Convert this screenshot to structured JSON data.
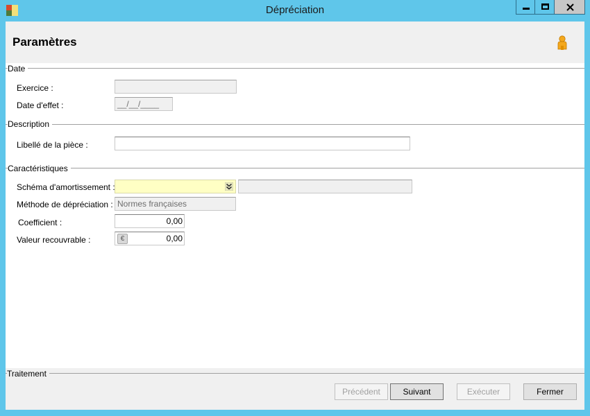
{
  "window": {
    "title": "Dépréciation"
  },
  "header": {
    "title": "Paramètres"
  },
  "sections": {
    "date": {
      "label": "Date",
      "exercice_label": "Exercice :",
      "exercice_value": "",
      "date_effet_label": "Date d'effet :",
      "date_effet_value": "__/__/____"
    },
    "description": {
      "label": "Description",
      "libelle_label": "Libellé de la pièce :",
      "libelle_value": ""
    },
    "caracteristiques": {
      "label": "Caractéristiques",
      "schema_label": "Schéma d'amortissement :",
      "schema_value": "",
      "schema_description": "",
      "methode_label": "Méthode de dépréciation :",
      "methode_value": "Normes françaises",
      "coefficient_label": "Coefficient :",
      "coefficient_value": "0,00",
      "valeur_label": "Valeur recouvrable :",
      "valeur_value": "0,00",
      "currency_symbol": "€"
    }
  },
  "footer": {
    "label": "Traitement",
    "buttons": {
      "precedent": "Précédent",
      "suivant": "Suivant",
      "executer": "Exécuter",
      "fermer": "Fermer"
    }
  },
  "colors": {
    "title_bar": "#5fc6ea",
    "required_field": "#ffffc4",
    "panel_background": "#f0f0f0"
  }
}
